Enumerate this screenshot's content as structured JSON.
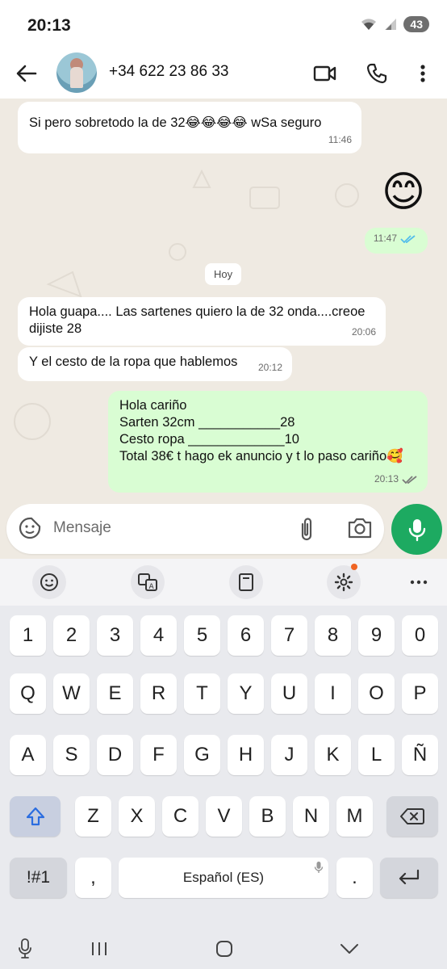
{
  "status_bar": {
    "time": "20:13",
    "battery": "43"
  },
  "header": {
    "contact": "+34 622 23 86 33"
  },
  "messages": [
    {
      "text": "Si pero sobretodo la de 32😂😂😂😂 wSa seguro",
      "time": "11:46"
    },
    {
      "emoji": "😊",
      "time": "11:47"
    },
    {
      "day": "Hoy"
    },
    {
      "text": "Hola guapa.... Las sartenes quiero la de 32 onda....creoe dijiste 28",
      "time": "20:06"
    },
    {
      "text": "Y el cesto de la ropa que hablemos",
      "time": "20:12"
    },
    {
      "lines": [
        "Hola cariño",
        "Sarten 32cm ___________28",
        "Cesto ropa _____________10",
        "Total 38€ t hago ek anuncio y t lo paso cariño🥰"
      ],
      "time": "20:13"
    }
  ],
  "input": {
    "placeholder": "Mensaje"
  },
  "keyboard": {
    "row_numbers": [
      "1",
      "2",
      "3",
      "4",
      "5",
      "6",
      "7",
      "8",
      "9",
      "0"
    ],
    "row1": [
      "Q",
      "W",
      "E",
      "R",
      "T",
      "Y",
      "U",
      "I",
      "O",
      "P"
    ],
    "row2": [
      "A",
      "S",
      "D",
      "F",
      "G",
      "H",
      "J",
      "K",
      "L",
      "Ñ"
    ],
    "row3": [
      "Z",
      "X",
      "C",
      "V",
      "B",
      "N",
      "M"
    ],
    "symbols_label": "!#1",
    "comma": ",",
    "space_label": "Español (ES)",
    "period": "."
  },
  "colors": {
    "chat_bg": "#efeae2",
    "outgoing": "#d9fdd3",
    "incoming": "#ffffff",
    "accent": "#1daa61",
    "read_ticks": "#53bdeb"
  }
}
